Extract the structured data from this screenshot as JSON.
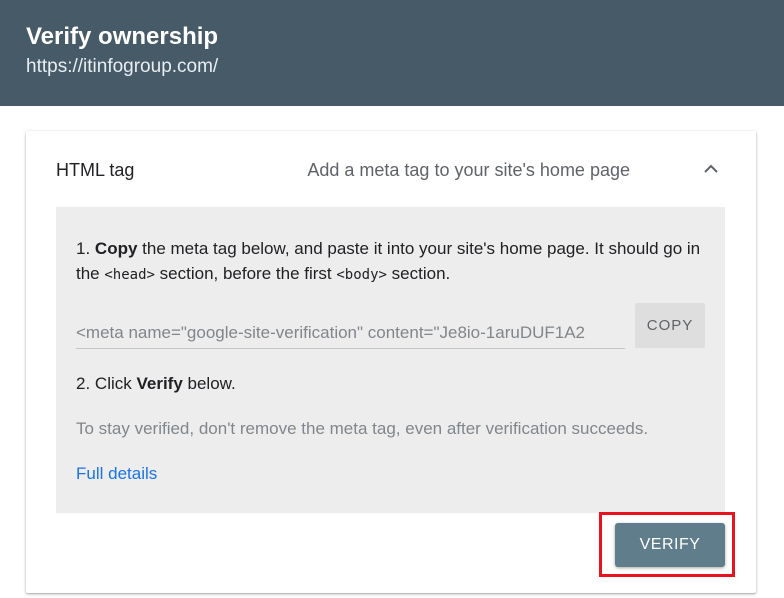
{
  "header": {
    "title": "Verify ownership",
    "url": "https://itinfogroup.com/"
  },
  "method": {
    "title": "HTML tag",
    "description": "Add a meta tag to your site's home page",
    "expanded": true,
    "collapse_icon": "chevron-up-icon"
  },
  "instructions": {
    "step1": {
      "number": "1.",
      "action": "Copy",
      "text_a": " the meta tag below, and paste it into your site's home page. It should go in the ",
      "tag_head": "<head>",
      "text_b": " section, before the first ",
      "tag_body": "<body>",
      "text_c": " section."
    },
    "meta_tag_value": "<meta name=\"google-site-verification\" content=\"Je8io-1aruDUF1A2",
    "copy_label": "COPY",
    "step2": {
      "number": "2.",
      "prefix": " Click ",
      "action": "Verify",
      "suffix": " below."
    },
    "note": "To stay verified, don't remove the meta tag, even after verification succeeds.",
    "full_details_label": "Full details"
  },
  "actions": {
    "verify_label": "VERIFY"
  },
  "colors": {
    "header_bg": "#475a67",
    "panel_bg": "#ededed",
    "verify_bg": "#607d8b",
    "link": "#1a73e8",
    "highlight": "#e8131f"
  }
}
